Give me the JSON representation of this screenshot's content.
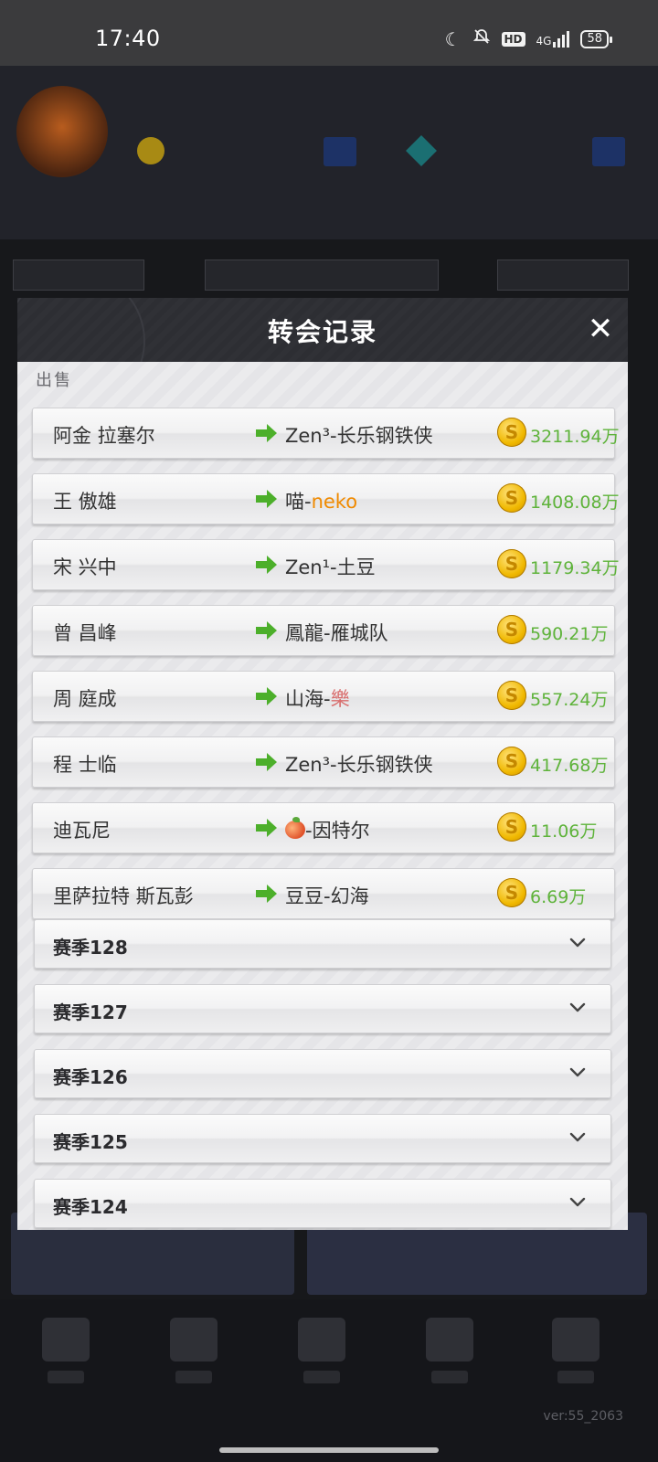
{
  "status_bar": {
    "time": "17:40",
    "hd": "HD",
    "network": "4G",
    "battery": "58",
    "icons": [
      "moon-icon",
      "bell-off-icon",
      "hd-icon",
      "signal-icon",
      "battery-icon"
    ]
  },
  "dialog": {
    "title": "转会记录",
    "close_label": "✕",
    "section_label": "出售",
    "records": [
      {
        "player": "阿金 拉塞尔",
        "team": "Zen³-长乐钢铁侠",
        "fee": "3211.94万"
      },
      {
        "player": "王 傲雄",
        "team_prefix": "喵-",
        "team_highlight": "neko",
        "highlight_color": "#f08a00",
        "fee": "1408.08万"
      },
      {
        "player": "宋 兴中",
        "team": "Zen¹-土豆",
        "fee": "1179.34万"
      },
      {
        "player": "曾 昌峰",
        "team": "鳳龍-雁城队",
        "fee": "590.21万"
      },
      {
        "player": "周 庭成",
        "team_prefix": "山海-",
        "team_highlight": "樂",
        "highlight_color": "#d86c6c",
        "fee": "557.24万"
      },
      {
        "player": "程 士临",
        "team": "Zen³-长乐钢铁侠",
        "fee": "417.68万"
      },
      {
        "player": "迪瓦尼",
        "team_icon": "peach-icon",
        "team": "-因特尔",
        "fee": "11.06万"
      },
      {
        "player": "里萨拉特 斯瓦彭",
        "team": "豆豆-幻海",
        "fee": "6.69万"
      }
    ],
    "coin_symbol": "S",
    "seasons": [
      "赛季128",
      "赛季127",
      "赛季126",
      "赛季125",
      "赛季124"
    ]
  },
  "footer": {
    "version": "ver:55_2063"
  },
  "colors": {
    "fee_green": "#5eb33a",
    "arrow_green": "#4caf2a",
    "coin_gold": "#f0b800"
  }
}
